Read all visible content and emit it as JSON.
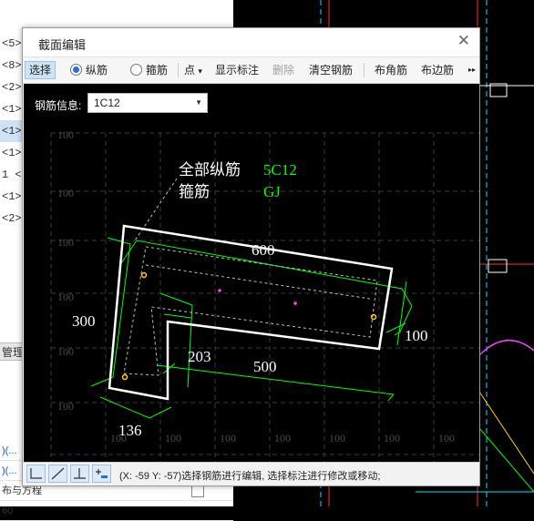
{
  "left_panel": {
    "items": [
      "<5>",
      "<8>",
      "<2>",
      "<1>",
      "<1>",
      "<1>",
      "1 <",
      "<1>",
      "<2>"
    ],
    "tab_label": "管理",
    "rows": [
      {
        "text": ")(..."
      },
      {
        "text": ")(..."
      },
      {
        "text": "布与方程"
      },
      {
        "text": "60"
      }
    ]
  },
  "dialog": {
    "title": "截面编辑",
    "close_glyph": "✕",
    "toolbar": {
      "select": "选择",
      "longitudinal": "纵筋",
      "stirrup": "箍筋",
      "point": "点",
      "point_arrow": "▾",
      "show_dimension": "显示标注",
      "delete": "删除",
      "clear_rebar": "清空钢筋",
      "corner_rebar": "布角筋",
      "edge_rebar": "布边筋",
      "more": "▸▸"
    },
    "rebar_info_label": "钢筋信息:",
    "rebar_info_value": "1C12",
    "canvas": {
      "grid_label": "100",
      "all_long_label": "全部纵筋",
      "all_long_value": "5C12",
      "stirrup_label": "箍筋",
      "stirrup_value": "GJ",
      "dim_top": "600",
      "dim_left": "300",
      "dim_right": "100",
      "dim_inner": "203",
      "dim_bottom": "500",
      "dim_base": "136"
    },
    "status": "(X: -59 Y: -57)选择钢筋进行编辑, 选择标注进行修改或移动;"
  },
  "colors": {
    "canvas_bg": "#000000",
    "section_outline": "#ffffff",
    "dimension": "#00ff00",
    "label_text": "#ffffff",
    "label_value": "#00ff00",
    "rebar_point": "#ffd700",
    "rebar_mid": "#ff40ff",
    "selection_bg": "#cfe3f7"
  }
}
